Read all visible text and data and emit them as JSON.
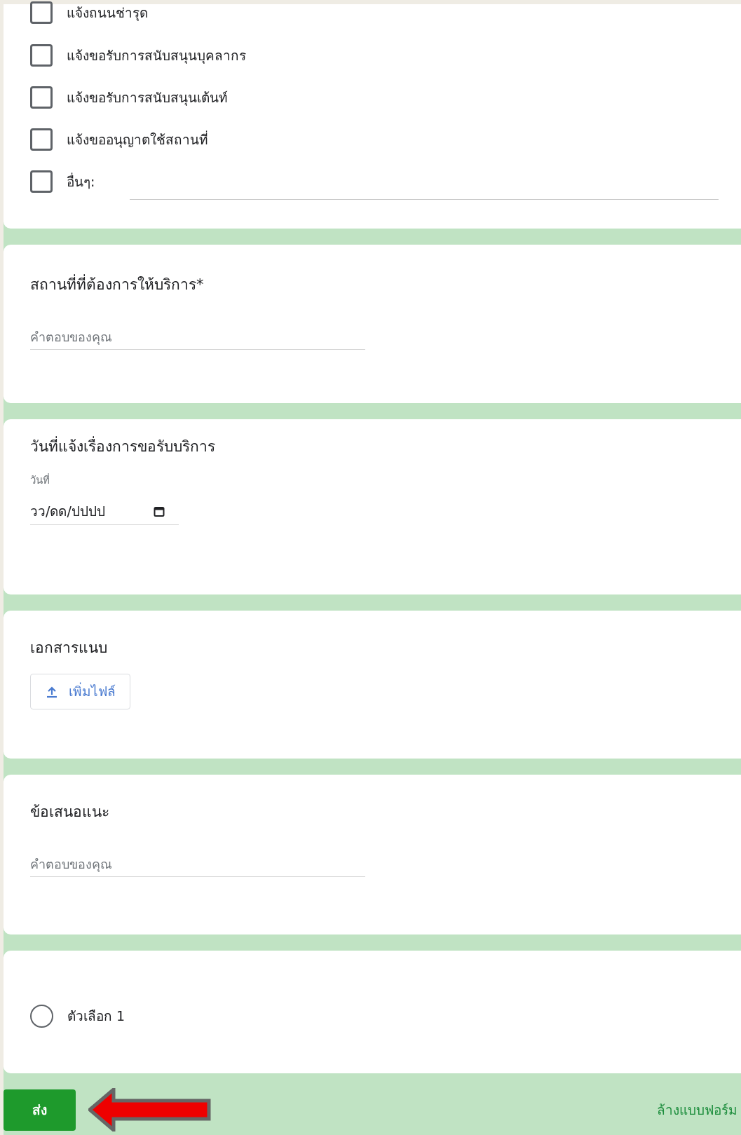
{
  "sections": [
    {
      "kind": "checkboxes",
      "options": [
        {
          "label": "แจ้งถนนช่ารุด",
          "checked": false
        },
        {
          "label": "แจ้งขอรับการสนับสนุนบุคลากร",
          "checked": false
        },
        {
          "label": "แจ้งขอรับการสนับสนุนเต้นท์",
          "checked": false
        },
        {
          "label": "แจ้งขออนุญาตใช้สถานที่",
          "checked": false
        }
      ],
      "other": {
        "label": "อื่นๆ:",
        "checked": false
      }
    },
    {
      "kind": "text",
      "title": "สถานที่ที่ต้องการให้บริการ*",
      "placeholder": "คำตอบของคุณ"
    },
    {
      "kind": "date",
      "title": "วันที่แจ้งเรื่องการขอรับบริการ",
      "sublabel": "วันที่",
      "placeholder": "วว/ดด/ปปปป"
    },
    {
      "kind": "file",
      "title": "เอกสารแนบ",
      "button": "เพิ่มไฟล์"
    },
    {
      "kind": "text",
      "title": "ข้อเสนอแนะ",
      "placeholder": "คำตอบของคุณ"
    },
    {
      "kind": "radio",
      "options": [
        {
          "label": "ตัวเลือก 1",
          "selected": false
        }
      ]
    }
  ],
  "footer": {
    "submit": "ส่ง",
    "clear": "ล้างแบบฟอร์ม"
  }
}
